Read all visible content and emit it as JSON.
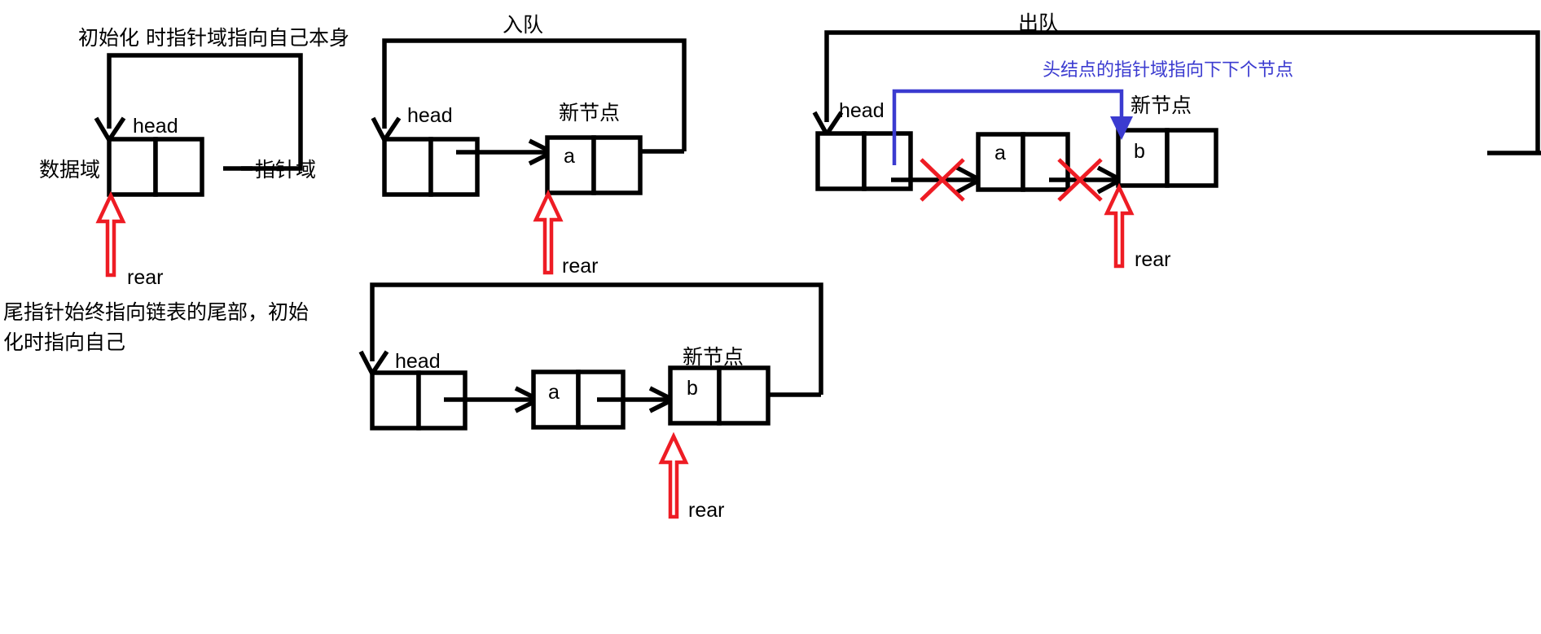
{
  "diagram": {
    "title_panels": {
      "init": "初始化 时指针域指向自己本身",
      "enqueue": "入队",
      "dequeue": "出队"
    },
    "labels": {
      "head": "head",
      "rear": "rear",
      "new_node": "新节点",
      "data_field": "数据域",
      "pointer_field": "指针域"
    },
    "values": {
      "a": "a",
      "b": "b"
    },
    "notes": {
      "tail_pointer_line1": "尾指针始终指向链表的尾部，初始",
      "tail_pointer_line2": "化时指向自己",
      "head_pointer_blue": "头结点的指针域指向下下个节点"
    },
    "colors": {
      "ink": "#000000",
      "rear_arrow": "#ee1c24",
      "cross_mark": "#ee1c24",
      "annotation_blue": "#3b3bd0",
      "background": "#ffffff"
    },
    "panels": [
      {
        "id": "init",
        "title": "初始化 时指针域指向自己本身",
        "nodes": [
          {
            "value": "",
            "label": "head"
          }
        ],
        "rear_points_to": "head",
        "self_loop": true,
        "side_labels": [
          "数据域",
          "指针域"
        ]
      },
      {
        "id": "enqueue-step1",
        "title": "入队",
        "nodes": [
          {
            "value": "",
            "label": "head"
          },
          {
            "value": "a",
            "label": "新节点"
          }
        ],
        "rear_points_to": "a",
        "self_loop": true
      },
      {
        "id": "enqueue-step2",
        "title": "",
        "nodes": [
          {
            "value": "",
            "label": "head"
          },
          {
            "value": "a",
            "label": ""
          },
          {
            "value": "b",
            "label": "新节点"
          }
        ],
        "rear_points_to": "b",
        "self_loop": true
      },
      {
        "id": "dequeue",
        "title": "出队",
        "nodes": [
          {
            "value": "",
            "label": "head"
          },
          {
            "value": "a",
            "label": ""
          },
          {
            "value": "b",
            "label": "新节点"
          }
        ],
        "rear_points_to": "b",
        "self_loop": true,
        "broken_links": 2,
        "annotation": "头结点的指针域指向下下个节点"
      }
    ]
  }
}
